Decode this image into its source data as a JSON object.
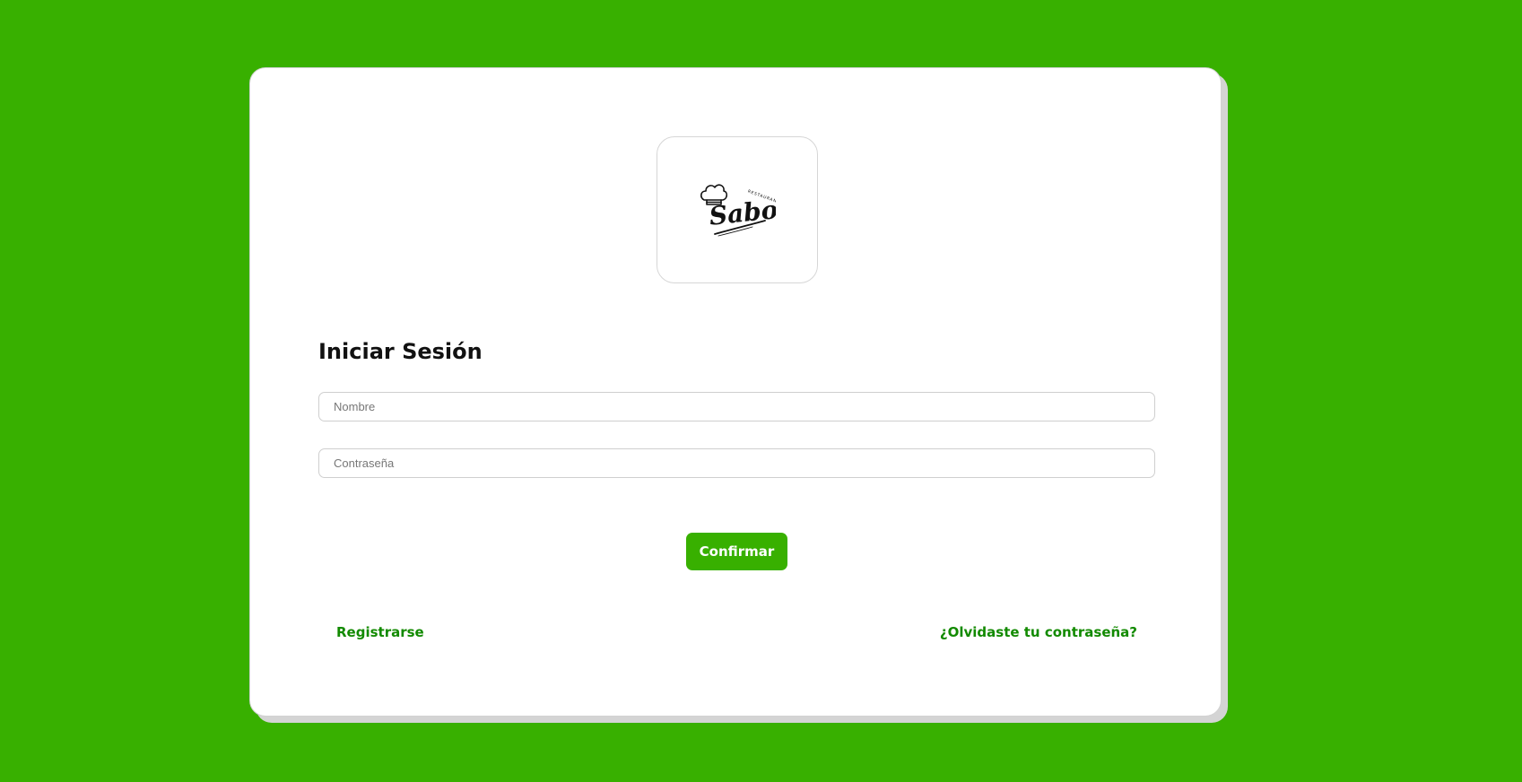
{
  "login": {
    "title": "Iniciar Sesión",
    "name_placeholder": "Nombre",
    "password_placeholder": "Contraseña",
    "confirm_label": "Confirmar",
    "register_link": "Registrarse",
    "forgot_link": "¿Olvidaste tu contraseña?"
  },
  "logo": {
    "wordmark": "Sabor",
    "tagline": "RESTAURANT",
    "icon": "chef-hat-icon"
  },
  "colors": {
    "background": "#38b000",
    "button": "#38b000",
    "link": "#128a00",
    "card": "#ffffff"
  }
}
